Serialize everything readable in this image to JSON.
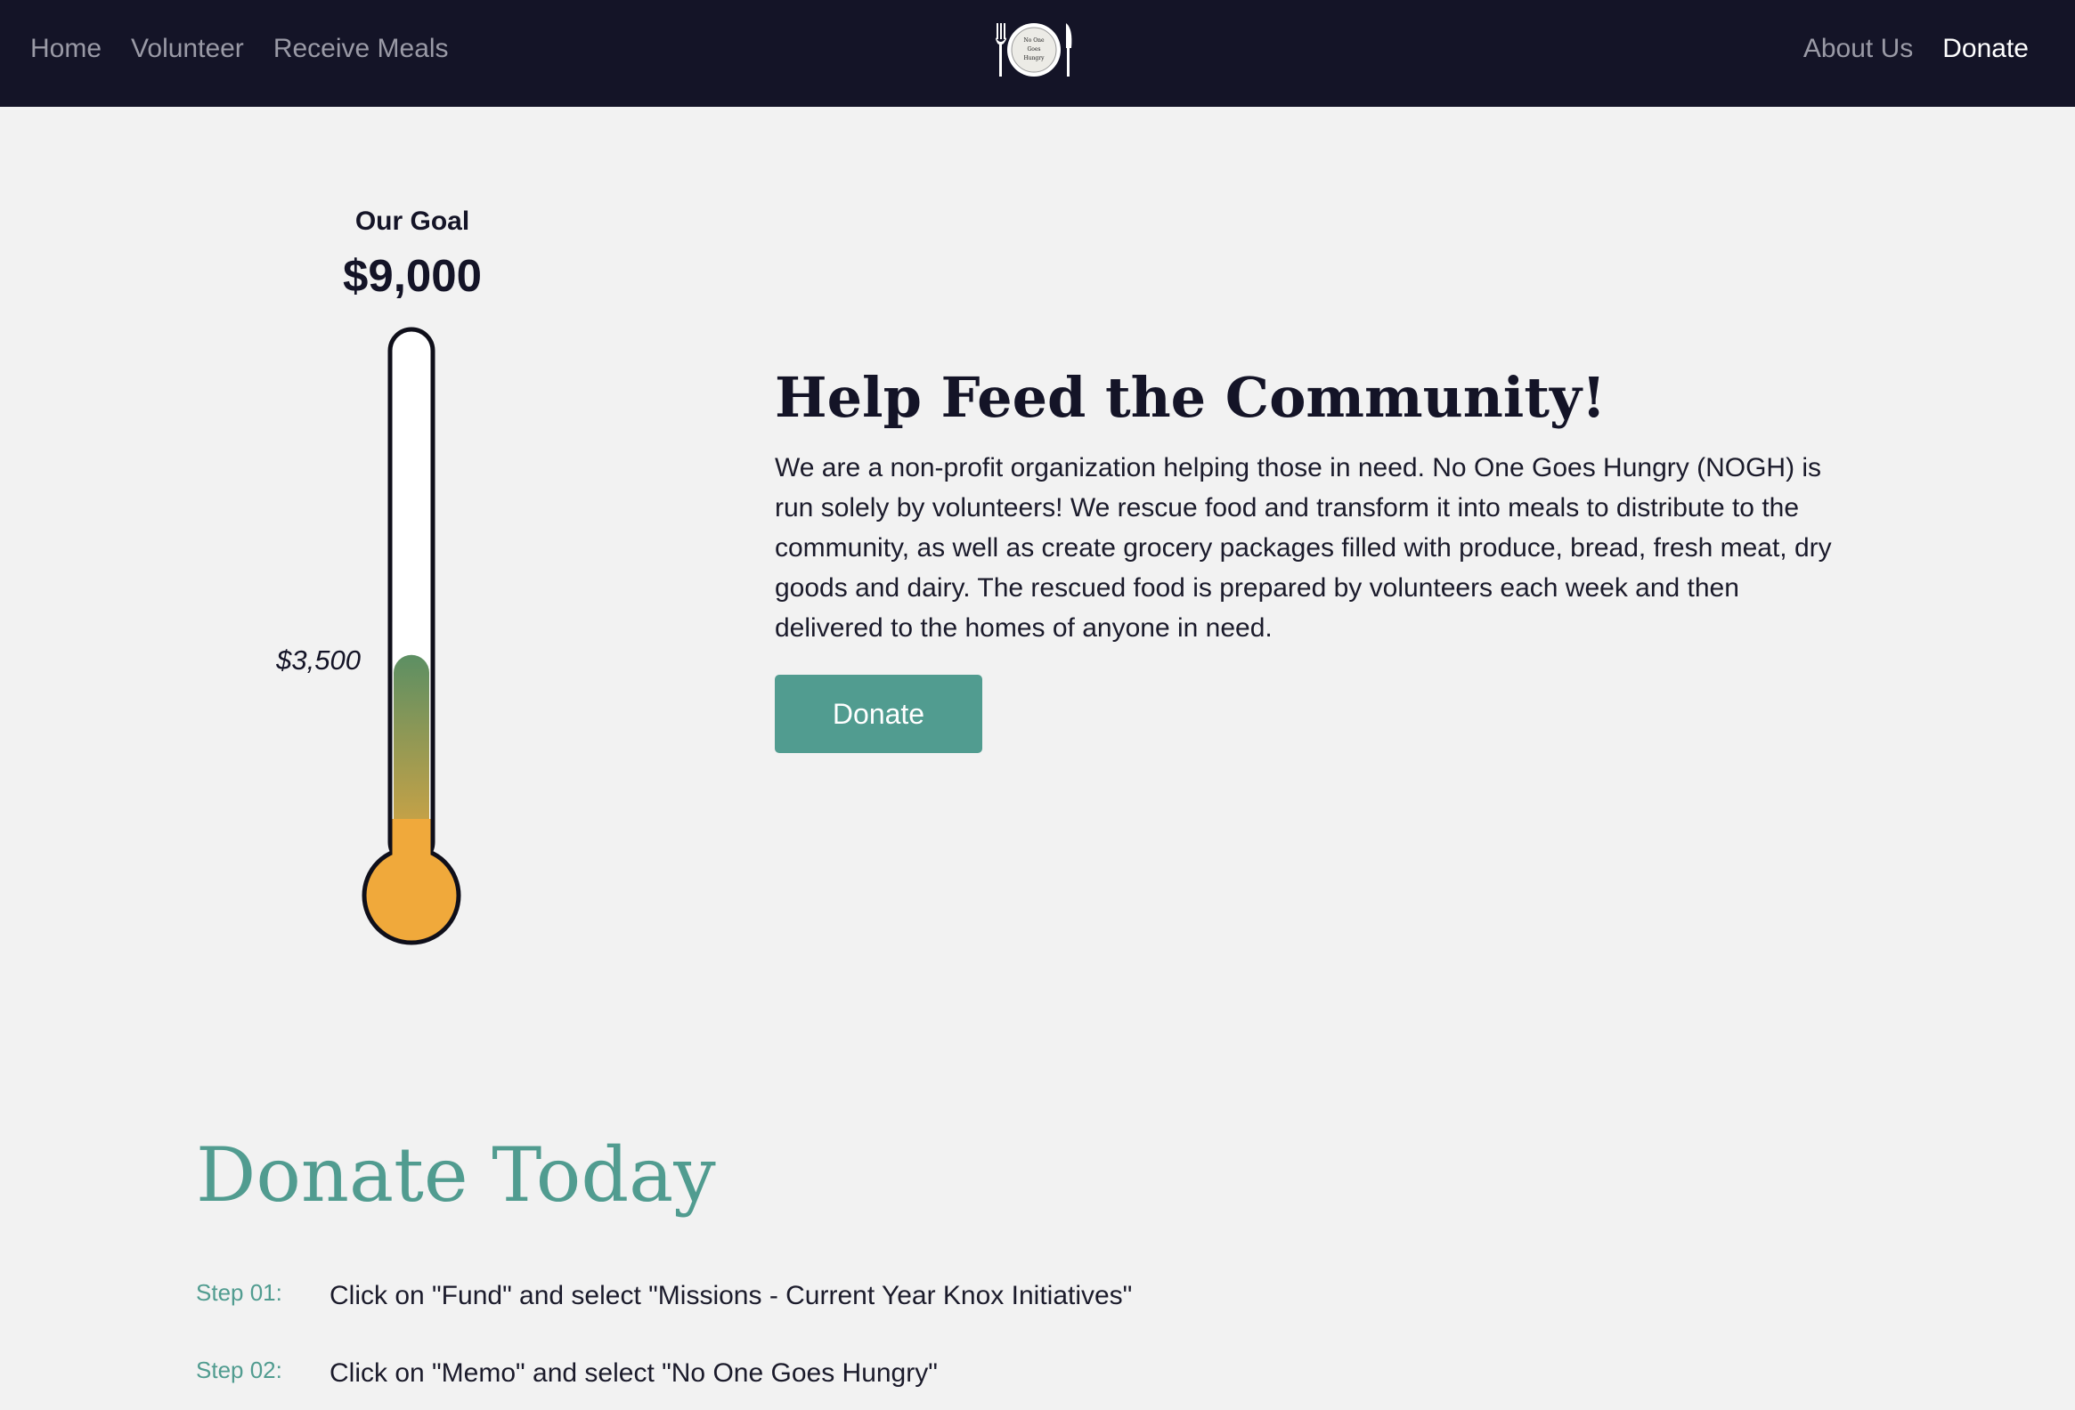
{
  "nav": {
    "left_links": [
      "Home",
      "Volunteer",
      "Receive Meals"
    ],
    "right_links": [
      "About Us",
      "Donate"
    ],
    "active_link": "Donate",
    "logo_text": [
      "No One",
      "Goes",
      "Hungry"
    ]
  },
  "goal": {
    "label": "Our Goal",
    "amount_text": "$9,000",
    "raised_text": "$3,500",
    "target_value": 9000,
    "raised_value": 3500,
    "colors": {
      "fill_top": "#5c8f63",
      "fill_bottom": "#f0a93b",
      "bulb": "#f0a93b",
      "outline": "#0f0f1a"
    }
  },
  "hero": {
    "title": "Help Feed the Community!",
    "paragraph": "We are a non-profit organization helping those in need. No One Goes Hungry (NOGH) is run solely by volunteers! We rescue food and transform it into meals to distribute to the community, as well as create grocery packages filled with produce, bread, fresh meat, dry goods and dairy. The rescued food is prepared by volunteers each week and then delivered to the homes of anyone in need.",
    "button_label": "Donate"
  },
  "donate_today": {
    "title": "Donate Today",
    "steps": [
      {
        "label": "Step 01:",
        "text": "Click on \"Fund\" and select \"Missions - Current Year Knox Initiatives\""
      },
      {
        "label": "Step 02:",
        "text": "Click on \"Memo\" and select \"No One Goes Hungry\""
      }
    ]
  },
  "colors": {
    "navbar_bg": "#141427",
    "page_bg": "#f2f2f2",
    "accent": "#519c90",
    "nav_inactive": "#9a9aa6",
    "nav_active": "#ffffff"
  }
}
